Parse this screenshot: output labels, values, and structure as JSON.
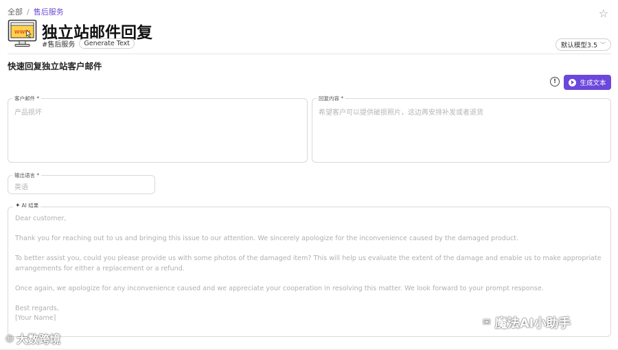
{
  "breadcrumb": {
    "root": "全部",
    "separator": "/",
    "current": "售后服务"
  },
  "header": {
    "title": "独立站邮件回复",
    "category_tag": "#售后服务",
    "pill_tag": "Generate Text",
    "model_select": "默认模型3.5"
  },
  "subtitle": "快速回复独立站客户邮件",
  "actions": {
    "generate_label": "生成文本"
  },
  "fields": {
    "customer_email": {
      "label": "客户邮件 *",
      "value": "产品损坏"
    },
    "reply_content": {
      "label": "回复内容 *",
      "value": "希望客户可以提供破损照片，这边再安排补发或者退货"
    },
    "output_language": {
      "label": "输出语言 *",
      "value": "英语"
    }
  },
  "result": {
    "label": "AI 结果",
    "lines": [
      "Dear customer,",
      "Thank you for reaching out to us and bringing this issue to our attention. We sincerely apologize for the inconvenience caused by the damaged product.",
      "To better assist you, could you please provide us with some photos of the damaged item? This will help us evaluate the extent of the damage and enable us to make appropriate arrangements for either a replacement or a refund.",
      "Once again, we apologize for any inconvenience caused and we appreciate your cooperation in resolving this matter. We look forward to your prompt response.",
      "Best regards,",
      "[Your Name]"
    ]
  },
  "watermarks": {
    "left": "大数跨境",
    "right": "魔法AI小助手"
  },
  "colors": {
    "accent": "#6b47dc",
    "breadcrumb_active": "#6a4bd6"
  }
}
